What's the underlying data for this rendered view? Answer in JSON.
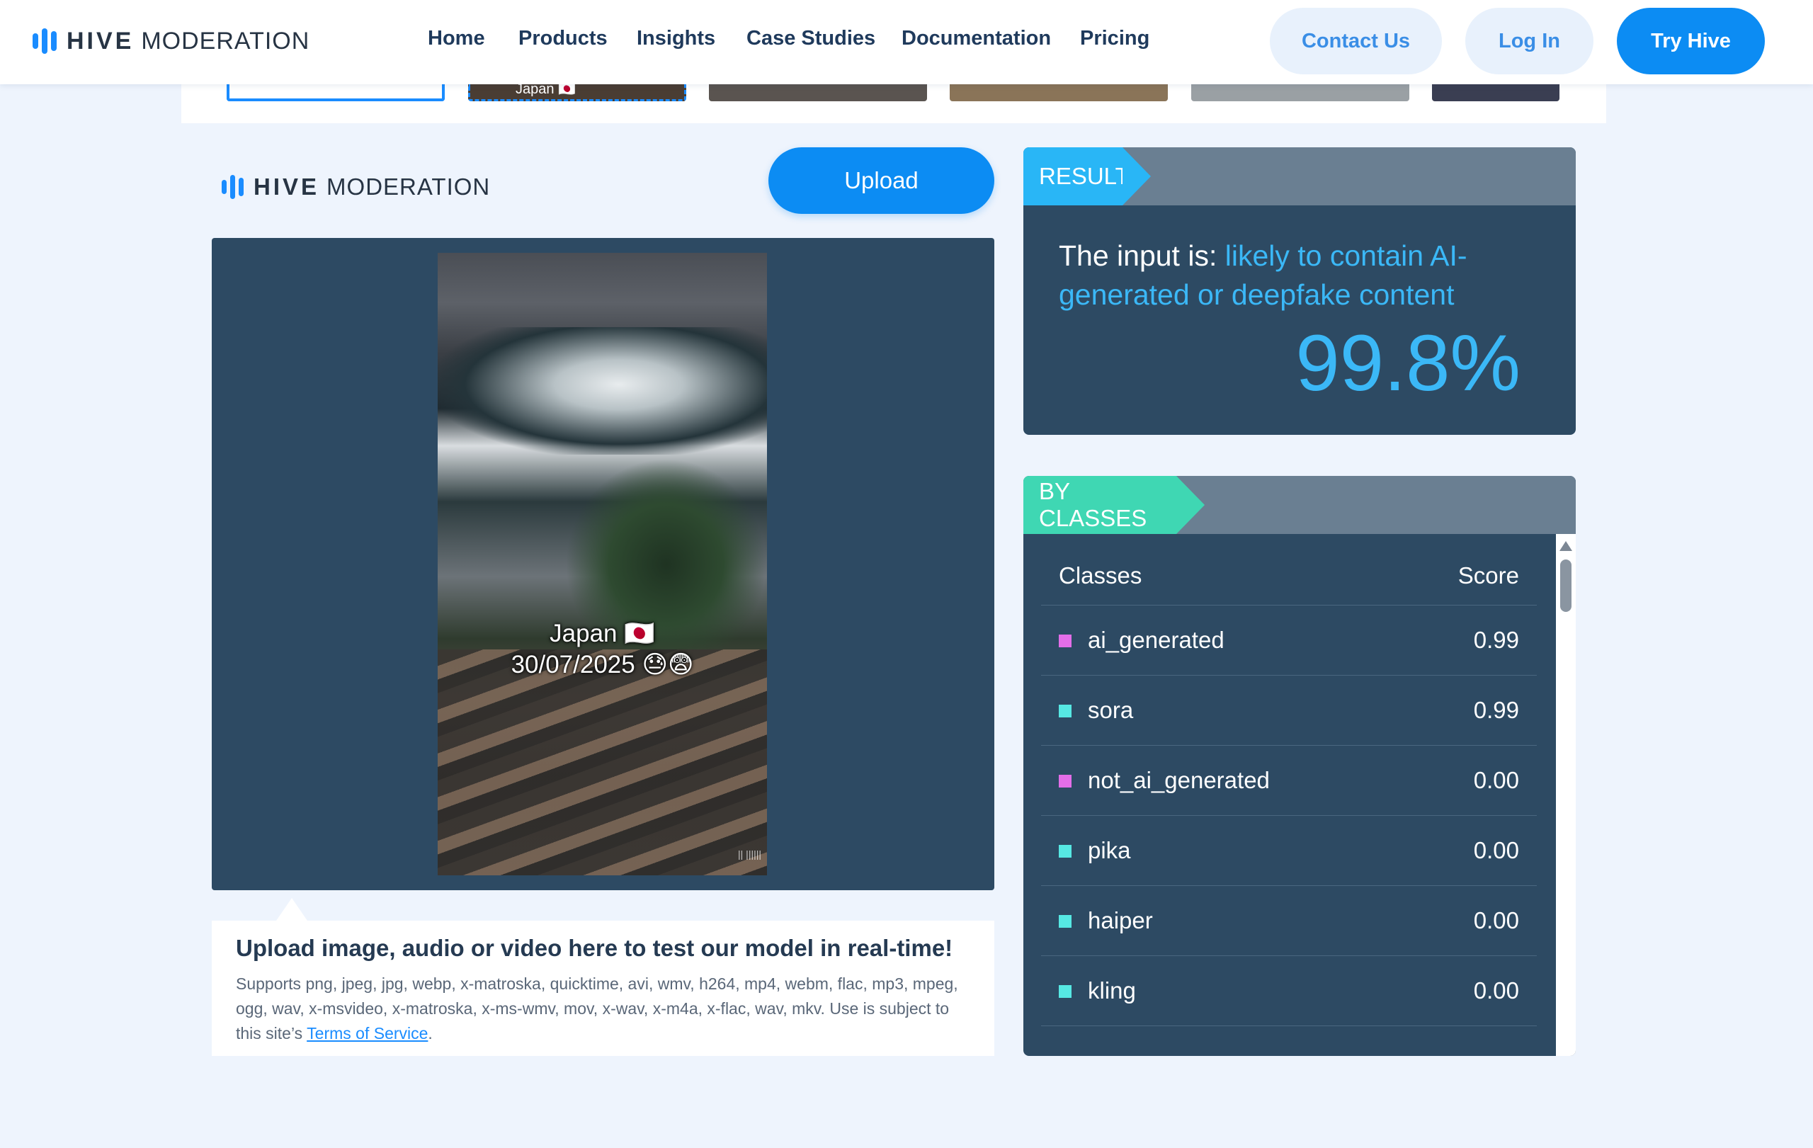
{
  "header": {
    "brand_bold": "HIVE",
    "brand_light": "MODERATION",
    "nav": [
      "Home",
      "Products",
      "Insights",
      "Case Studies",
      "Documentation",
      "Pricing"
    ],
    "contact_label": "Contact Us",
    "login_label": "Log In",
    "try_label": "Try Hive"
  },
  "strip": {
    "thumb_caption": "Japan 🇯🇵"
  },
  "upload": {
    "brand_bold": "HIVE",
    "brand_light": "MODERATION",
    "button_label": "Upload"
  },
  "preview": {
    "caption_line1": "Japan 🇯🇵",
    "caption_line2": "30/07/2025 😓😨",
    "watermark": "|| ||||||"
  },
  "info": {
    "title": "Upload image, audio or video here to test our model in real-time!",
    "desc": "Supports png, jpeg, jpg, webp, x-matroska, quicktime, avi, wmv, h264, mp4, webm, flac, mp3, mpeg, ogg, wav, x-msvideo, x-matroska, x-ms-wmv, mov, x-wav, x-m4a, x-flac, wav, mkv. Use is subject to this site’s ",
    "link_label": "Terms of Service",
    "desc_end": "."
  },
  "result": {
    "tab_label": "RESULT",
    "prefix": "The input is: ",
    "verdict": "likely to contain AI-generated or deepfake content",
    "percent": "99.8%"
  },
  "classes": {
    "tab_label": "BY CLASSES",
    "col_class": "Classes",
    "col_score": "Score",
    "rows": [
      {
        "name": "ai_generated",
        "score": "0.99",
        "color": "#e36ee8"
      },
      {
        "name": "sora",
        "score": "0.99",
        "color": "#56e8e3"
      },
      {
        "name": "not_ai_generated",
        "score": "0.00",
        "color": "#e36ee8"
      },
      {
        "name": "pika",
        "score": "0.00",
        "color": "#56e8e3"
      },
      {
        "name": "haiper",
        "score": "0.00",
        "color": "#56e8e3"
      },
      {
        "name": "kling",
        "score": "0.00",
        "color": "#56e8e3"
      }
    ]
  },
  "colors": {
    "accent_blue": "#0c8cf3",
    "result_highlight": "#3bb8f7",
    "panel_bg": "#2d4a63",
    "classes_tab": "#3fd7b3",
    "result_tab": "#29b6f6"
  }
}
